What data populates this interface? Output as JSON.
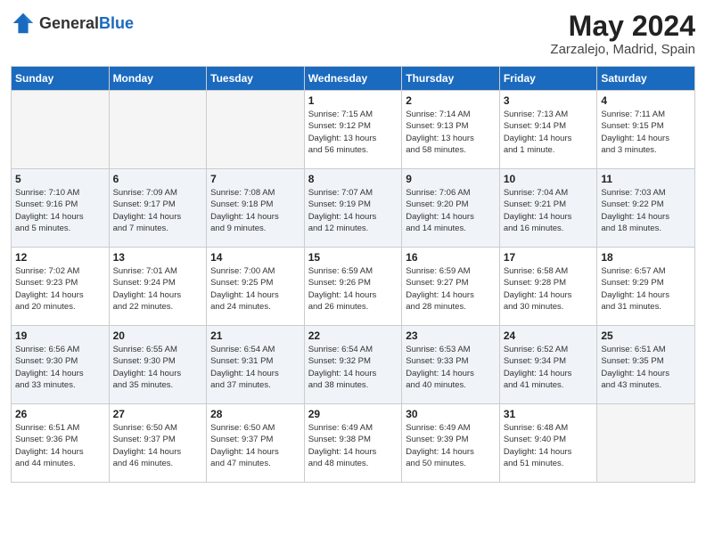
{
  "header": {
    "logo_general": "General",
    "logo_blue": "Blue",
    "month": "May 2024",
    "location": "Zarzalejo, Madrid, Spain"
  },
  "days_of_week": [
    "Sunday",
    "Monday",
    "Tuesday",
    "Wednesday",
    "Thursday",
    "Friday",
    "Saturday"
  ],
  "weeks": [
    {
      "days": [
        {
          "num": "",
          "info": ""
        },
        {
          "num": "",
          "info": ""
        },
        {
          "num": "",
          "info": ""
        },
        {
          "num": "1",
          "info": "Sunrise: 7:15 AM\nSunset: 9:12 PM\nDaylight: 13 hours\nand 56 minutes."
        },
        {
          "num": "2",
          "info": "Sunrise: 7:14 AM\nSunset: 9:13 PM\nDaylight: 13 hours\nand 58 minutes."
        },
        {
          "num": "3",
          "info": "Sunrise: 7:13 AM\nSunset: 9:14 PM\nDaylight: 14 hours\nand 1 minute."
        },
        {
          "num": "4",
          "info": "Sunrise: 7:11 AM\nSunset: 9:15 PM\nDaylight: 14 hours\nand 3 minutes."
        }
      ]
    },
    {
      "days": [
        {
          "num": "5",
          "info": "Sunrise: 7:10 AM\nSunset: 9:16 PM\nDaylight: 14 hours\nand 5 minutes."
        },
        {
          "num": "6",
          "info": "Sunrise: 7:09 AM\nSunset: 9:17 PM\nDaylight: 14 hours\nand 7 minutes."
        },
        {
          "num": "7",
          "info": "Sunrise: 7:08 AM\nSunset: 9:18 PM\nDaylight: 14 hours\nand 9 minutes."
        },
        {
          "num": "8",
          "info": "Sunrise: 7:07 AM\nSunset: 9:19 PM\nDaylight: 14 hours\nand 12 minutes."
        },
        {
          "num": "9",
          "info": "Sunrise: 7:06 AM\nSunset: 9:20 PM\nDaylight: 14 hours\nand 14 minutes."
        },
        {
          "num": "10",
          "info": "Sunrise: 7:04 AM\nSunset: 9:21 PM\nDaylight: 14 hours\nand 16 minutes."
        },
        {
          "num": "11",
          "info": "Sunrise: 7:03 AM\nSunset: 9:22 PM\nDaylight: 14 hours\nand 18 minutes."
        }
      ]
    },
    {
      "days": [
        {
          "num": "12",
          "info": "Sunrise: 7:02 AM\nSunset: 9:23 PM\nDaylight: 14 hours\nand 20 minutes."
        },
        {
          "num": "13",
          "info": "Sunrise: 7:01 AM\nSunset: 9:24 PM\nDaylight: 14 hours\nand 22 minutes."
        },
        {
          "num": "14",
          "info": "Sunrise: 7:00 AM\nSunset: 9:25 PM\nDaylight: 14 hours\nand 24 minutes."
        },
        {
          "num": "15",
          "info": "Sunrise: 6:59 AM\nSunset: 9:26 PM\nDaylight: 14 hours\nand 26 minutes."
        },
        {
          "num": "16",
          "info": "Sunrise: 6:59 AM\nSunset: 9:27 PM\nDaylight: 14 hours\nand 28 minutes."
        },
        {
          "num": "17",
          "info": "Sunrise: 6:58 AM\nSunset: 9:28 PM\nDaylight: 14 hours\nand 30 minutes."
        },
        {
          "num": "18",
          "info": "Sunrise: 6:57 AM\nSunset: 9:29 PM\nDaylight: 14 hours\nand 31 minutes."
        }
      ]
    },
    {
      "days": [
        {
          "num": "19",
          "info": "Sunrise: 6:56 AM\nSunset: 9:30 PM\nDaylight: 14 hours\nand 33 minutes."
        },
        {
          "num": "20",
          "info": "Sunrise: 6:55 AM\nSunset: 9:30 PM\nDaylight: 14 hours\nand 35 minutes."
        },
        {
          "num": "21",
          "info": "Sunrise: 6:54 AM\nSunset: 9:31 PM\nDaylight: 14 hours\nand 37 minutes."
        },
        {
          "num": "22",
          "info": "Sunrise: 6:54 AM\nSunset: 9:32 PM\nDaylight: 14 hours\nand 38 minutes."
        },
        {
          "num": "23",
          "info": "Sunrise: 6:53 AM\nSunset: 9:33 PM\nDaylight: 14 hours\nand 40 minutes."
        },
        {
          "num": "24",
          "info": "Sunrise: 6:52 AM\nSunset: 9:34 PM\nDaylight: 14 hours\nand 41 minutes."
        },
        {
          "num": "25",
          "info": "Sunrise: 6:51 AM\nSunset: 9:35 PM\nDaylight: 14 hours\nand 43 minutes."
        }
      ]
    },
    {
      "days": [
        {
          "num": "26",
          "info": "Sunrise: 6:51 AM\nSunset: 9:36 PM\nDaylight: 14 hours\nand 44 minutes."
        },
        {
          "num": "27",
          "info": "Sunrise: 6:50 AM\nSunset: 9:37 PM\nDaylight: 14 hours\nand 46 minutes."
        },
        {
          "num": "28",
          "info": "Sunrise: 6:50 AM\nSunset: 9:37 PM\nDaylight: 14 hours\nand 47 minutes."
        },
        {
          "num": "29",
          "info": "Sunrise: 6:49 AM\nSunset: 9:38 PM\nDaylight: 14 hours\nand 48 minutes."
        },
        {
          "num": "30",
          "info": "Sunrise: 6:49 AM\nSunset: 9:39 PM\nDaylight: 14 hours\nand 50 minutes."
        },
        {
          "num": "31",
          "info": "Sunrise: 6:48 AM\nSunset: 9:40 PM\nDaylight: 14 hours\nand 51 minutes."
        },
        {
          "num": "",
          "info": ""
        }
      ]
    }
  ]
}
